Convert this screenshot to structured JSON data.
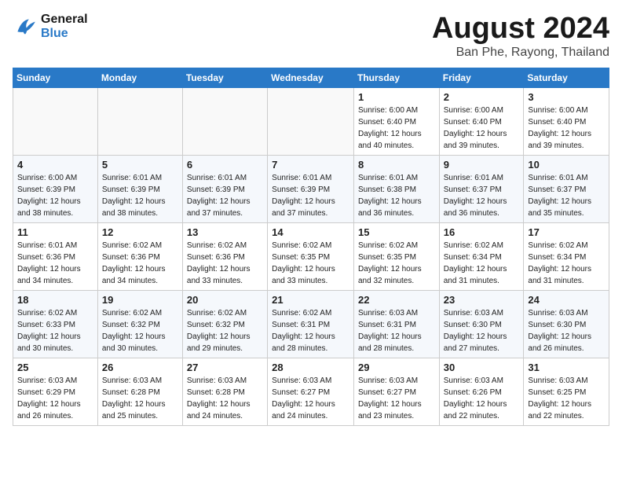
{
  "header": {
    "logo_line1": "General",
    "logo_line2": "Blue",
    "month": "August 2024",
    "location": "Ban Phe, Rayong, Thailand"
  },
  "weekdays": [
    "Sunday",
    "Monday",
    "Tuesday",
    "Wednesday",
    "Thursday",
    "Friday",
    "Saturday"
  ],
  "weeks": [
    [
      {
        "day": "",
        "info": ""
      },
      {
        "day": "",
        "info": ""
      },
      {
        "day": "",
        "info": ""
      },
      {
        "day": "",
        "info": ""
      },
      {
        "day": "1",
        "info": "Sunrise: 6:00 AM\nSunset: 6:40 PM\nDaylight: 12 hours\nand 40 minutes."
      },
      {
        "day": "2",
        "info": "Sunrise: 6:00 AM\nSunset: 6:40 PM\nDaylight: 12 hours\nand 39 minutes."
      },
      {
        "day": "3",
        "info": "Sunrise: 6:00 AM\nSunset: 6:40 PM\nDaylight: 12 hours\nand 39 minutes."
      }
    ],
    [
      {
        "day": "4",
        "info": "Sunrise: 6:00 AM\nSunset: 6:39 PM\nDaylight: 12 hours\nand 38 minutes."
      },
      {
        "day": "5",
        "info": "Sunrise: 6:01 AM\nSunset: 6:39 PM\nDaylight: 12 hours\nand 38 minutes."
      },
      {
        "day": "6",
        "info": "Sunrise: 6:01 AM\nSunset: 6:39 PM\nDaylight: 12 hours\nand 37 minutes."
      },
      {
        "day": "7",
        "info": "Sunrise: 6:01 AM\nSunset: 6:39 PM\nDaylight: 12 hours\nand 37 minutes."
      },
      {
        "day": "8",
        "info": "Sunrise: 6:01 AM\nSunset: 6:38 PM\nDaylight: 12 hours\nand 36 minutes."
      },
      {
        "day": "9",
        "info": "Sunrise: 6:01 AM\nSunset: 6:37 PM\nDaylight: 12 hours\nand 36 minutes."
      },
      {
        "day": "10",
        "info": "Sunrise: 6:01 AM\nSunset: 6:37 PM\nDaylight: 12 hours\nand 35 minutes."
      }
    ],
    [
      {
        "day": "11",
        "info": "Sunrise: 6:01 AM\nSunset: 6:36 PM\nDaylight: 12 hours\nand 34 minutes."
      },
      {
        "day": "12",
        "info": "Sunrise: 6:02 AM\nSunset: 6:36 PM\nDaylight: 12 hours\nand 34 minutes."
      },
      {
        "day": "13",
        "info": "Sunrise: 6:02 AM\nSunset: 6:36 PM\nDaylight: 12 hours\nand 33 minutes."
      },
      {
        "day": "14",
        "info": "Sunrise: 6:02 AM\nSunset: 6:35 PM\nDaylight: 12 hours\nand 33 minutes."
      },
      {
        "day": "15",
        "info": "Sunrise: 6:02 AM\nSunset: 6:35 PM\nDaylight: 12 hours\nand 32 minutes."
      },
      {
        "day": "16",
        "info": "Sunrise: 6:02 AM\nSunset: 6:34 PM\nDaylight: 12 hours\nand 31 minutes."
      },
      {
        "day": "17",
        "info": "Sunrise: 6:02 AM\nSunset: 6:34 PM\nDaylight: 12 hours\nand 31 minutes."
      }
    ],
    [
      {
        "day": "18",
        "info": "Sunrise: 6:02 AM\nSunset: 6:33 PM\nDaylight: 12 hours\nand 30 minutes."
      },
      {
        "day": "19",
        "info": "Sunrise: 6:02 AM\nSunset: 6:32 PM\nDaylight: 12 hours\nand 30 minutes."
      },
      {
        "day": "20",
        "info": "Sunrise: 6:02 AM\nSunset: 6:32 PM\nDaylight: 12 hours\nand 29 minutes."
      },
      {
        "day": "21",
        "info": "Sunrise: 6:02 AM\nSunset: 6:31 PM\nDaylight: 12 hours\nand 28 minutes."
      },
      {
        "day": "22",
        "info": "Sunrise: 6:03 AM\nSunset: 6:31 PM\nDaylight: 12 hours\nand 28 minutes."
      },
      {
        "day": "23",
        "info": "Sunrise: 6:03 AM\nSunset: 6:30 PM\nDaylight: 12 hours\nand 27 minutes."
      },
      {
        "day": "24",
        "info": "Sunrise: 6:03 AM\nSunset: 6:30 PM\nDaylight: 12 hours\nand 26 minutes."
      }
    ],
    [
      {
        "day": "25",
        "info": "Sunrise: 6:03 AM\nSunset: 6:29 PM\nDaylight: 12 hours\nand 26 minutes."
      },
      {
        "day": "26",
        "info": "Sunrise: 6:03 AM\nSunset: 6:28 PM\nDaylight: 12 hours\nand 25 minutes."
      },
      {
        "day": "27",
        "info": "Sunrise: 6:03 AM\nSunset: 6:28 PM\nDaylight: 12 hours\nand 24 minutes."
      },
      {
        "day": "28",
        "info": "Sunrise: 6:03 AM\nSunset: 6:27 PM\nDaylight: 12 hours\nand 24 minutes."
      },
      {
        "day": "29",
        "info": "Sunrise: 6:03 AM\nSunset: 6:27 PM\nDaylight: 12 hours\nand 23 minutes."
      },
      {
        "day": "30",
        "info": "Sunrise: 6:03 AM\nSunset: 6:26 PM\nDaylight: 12 hours\nand 22 minutes."
      },
      {
        "day": "31",
        "info": "Sunrise: 6:03 AM\nSunset: 6:25 PM\nDaylight: 12 hours\nand 22 minutes."
      }
    ]
  ]
}
